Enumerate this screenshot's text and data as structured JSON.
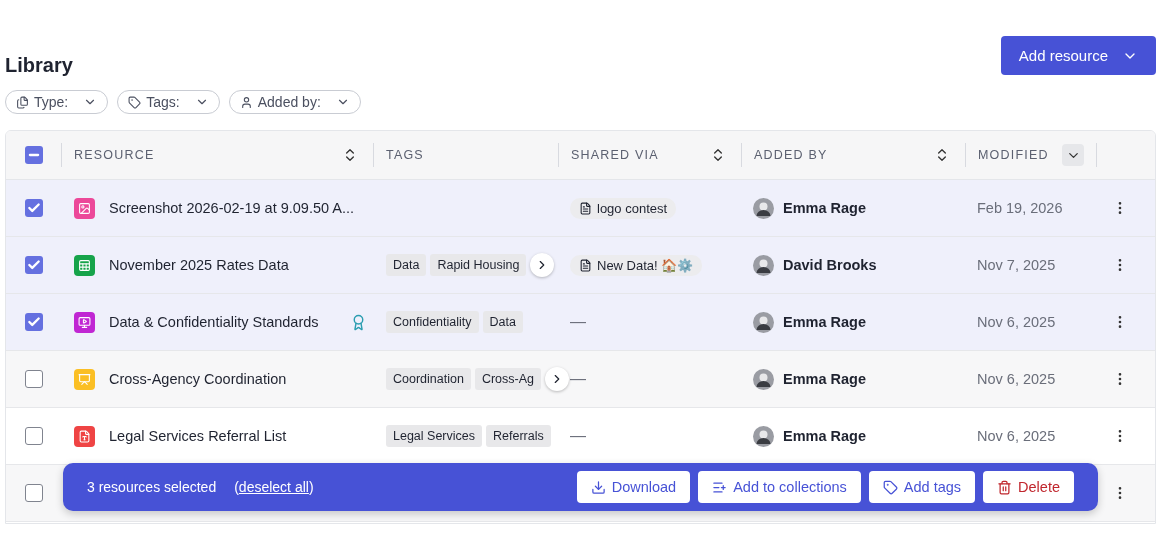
{
  "title": "Library",
  "add_button": {
    "label": "Add resource"
  },
  "filters": [
    {
      "kind": "type",
      "label": "Type:"
    },
    {
      "kind": "tags",
      "label": "Tags:"
    },
    {
      "kind": "person",
      "label": "Added by:"
    }
  ],
  "table": {
    "select_all": {
      "checked": true,
      "indeterminate": true
    },
    "columns": [
      {
        "label": "RESOURCE",
        "sortable": true,
        "sorted": false
      },
      {
        "label": "TAGS",
        "sortable": false
      },
      {
        "label": "SHARED VIA",
        "sortable": true,
        "sorted": false
      },
      {
        "label": "ADDED BY",
        "sortable": true,
        "sorted": false
      },
      {
        "label": "MODIFIED",
        "sortable": true,
        "sorted": true
      }
    ],
    "rows": [
      {
        "selected": true,
        "kind": "image",
        "name": "Screenshot 2026-02-19 at 9.09.50 A...",
        "featured": false,
        "tags": [],
        "tags_overflow": false,
        "shared_via": "logo contest",
        "added_by": "Emma Rage",
        "modified": "Feb 19, 2026"
      },
      {
        "selected": true,
        "kind": "sheet",
        "name": "November 2025 Rates Data",
        "featured": false,
        "tags": [
          "Data",
          "Rapid Housing"
        ],
        "tags_overflow": true,
        "shared_via": "New Data! 🏠⚙️",
        "added_by": "David Brooks",
        "modified": "Nov 7, 2025"
      },
      {
        "selected": true,
        "kind": "video",
        "name": "Data & Confidentiality Standards",
        "featured": true,
        "tags": [
          "Confidentiality",
          "Data"
        ],
        "tags_overflow": false,
        "shared_via_empty": "—",
        "added_by": "Emma Rage",
        "modified": "Nov 6, 2025"
      },
      {
        "selected": false,
        "kind": "slides",
        "name": "Cross-Agency Coordination",
        "featured": false,
        "tags": [
          "Coordination",
          "Cross-Ag"
        ],
        "tags_overflow": true,
        "shared_via_empty": "—",
        "added_by": "Emma Rage",
        "modified": "Nov 6, 2025"
      },
      {
        "selected": false,
        "kind": "pdf",
        "name": "Legal Services Referral List",
        "featured": false,
        "tags": [
          "Legal Services",
          "Referrals"
        ],
        "tags_overflow": false,
        "shared_via_empty": "—",
        "added_by": "Emma Rage",
        "modified": "Nov 6, 2025"
      },
      {
        "selected": false
      }
    ]
  },
  "bulk_bar": {
    "count_text": "3 resources selected",
    "deselect_open": "(",
    "deselect_link": "deselect all",
    "deselect_close": ")",
    "actions": [
      {
        "kind": "download",
        "label": "Download"
      },
      {
        "kind": "collection",
        "label": "Add to collections"
      },
      {
        "kind": "tag",
        "label": "Add tags"
      },
      {
        "kind": "delete",
        "label": "Delete"
      }
    ]
  }
}
